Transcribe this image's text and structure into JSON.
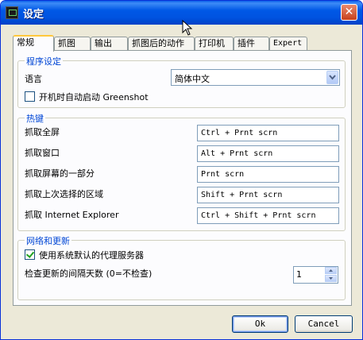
{
  "window": {
    "title": "设定",
    "close_symbol": "✕"
  },
  "tabs": [
    {
      "label": "常规",
      "active": true
    },
    {
      "label": "抓图"
    },
    {
      "label": "输出"
    },
    {
      "label": "抓图后的动作"
    },
    {
      "label": "打印机"
    },
    {
      "label": "插件"
    },
    {
      "label": "Expert"
    }
  ],
  "program_settings": {
    "legend": "程序设定",
    "language_label": "语言",
    "language_value": "简体中文",
    "autostart_label": "开机时自动启动 Greenshot",
    "autostart_checked": false
  },
  "hotkeys": {
    "legend": "热键",
    "rows": [
      {
        "label": "抓取全屏",
        "value": "Ctrl + Prnt scrn"
      },
      {
        "label": "抓取窗口",
        "value": "Alt + Prnt scrn"
      },
      {
        "label": "抓取屏幕的一部分",
        "value": "Prnt scrn"
      },
      {
        "label": "抓取上次选择的区域",
        "value": "Shift + Prnt scrn"
      },
      {
        "label": "抓取 Internet Explorer",
        "value": "Ctrl + Shift + Prnt scrn"
      }
    ]
  },
  "network": {
    "legend": "网络和更新",
    "proxy_label": "使用系统默认的代理服务器",
    "proxy_checked": true,
    "interval_label": "检查更新的间隔天数 (0=不检查)",
    "interval_value": "1"
  },
  "buttons": {
    "ok": "Ok",
    "cancel": "Cancel"
  }
}
